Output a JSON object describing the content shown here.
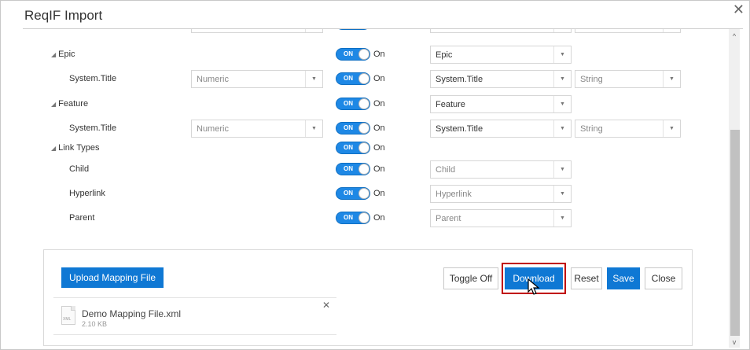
{
  "window": {
    "title": "ReqIF Import"
  },
  "rows": [
    {
      "kind": "group",
      "label": "Epic",
      "toggle": {
        "state": "ON",
        "label": "On"
      },
      "target": "Epic"
    },
    {
      "kind": "field",
      "label": "System.Title",
      "source_type": "Numeric",
      "toggle": {
        "state": "ON",
        "label": "On"
      },
      "target": "System.Title",
      "target_type": "String"
    },
    {
      "kind": "group",
      "label": "Feature",
      "toggle": {
        "state": "ON",
        "label": "On"
      },
      "target": "Feature"
    },
    {
      "kind": "field",
      "label": "System.Title",
      "source_type": "Numeric",
      "toggle": {
        "state": "ON",
        "label": "On"
      },
      "target": "System.Title",
      "target_type": "String"
    },
    {
      "kind": "group",
      "label": "Link Types",
      "toggle": {
        "state": "ON",
        "label": "On"
      }
    },
    {
      "kind": "link",
      "label": "Child",
      "toggle": {
        "state": "ON",
        "label": "On"
      },
      "target": "Child"
    },
    {
      "kind": "link",
      "label": "Hyperlink",
      "toggle": {
        "state": "ON",
        "label": "On"
      },
      "target": "Hyperlink"
    },
    {
      "kind": "link",
      "label": "Parent",
      "toggle": {
        "state": "ON",
        "label": "On"
      },
      "target": "Parent"
    }
  ],
  "panel": {
    "upload_label": "Upload Mapping File",
    "file": {
      "name": "Demo Mapping File.xml",
      "size": "2.10 KB",
      "icon_text": "XML"
    },
    "buttons": {
      "toggle_off": "Toggle Off",
      "download": "Download",
      "reset": "Reset",
      "save": "Save",
      "close": "Close"
    }
  },
  "colors": {
    "primary": "#0f78d4",
    "highlight": "#c00000"
  },
  "icons": {
    "close": "close-icon",
    "caret": "triangle-expand-icon",
    "dropdown": "chevron-down-icon",
    "file": "xml-file-icon",
    "cursor": "mouse-pointer-icon"
  }
}
